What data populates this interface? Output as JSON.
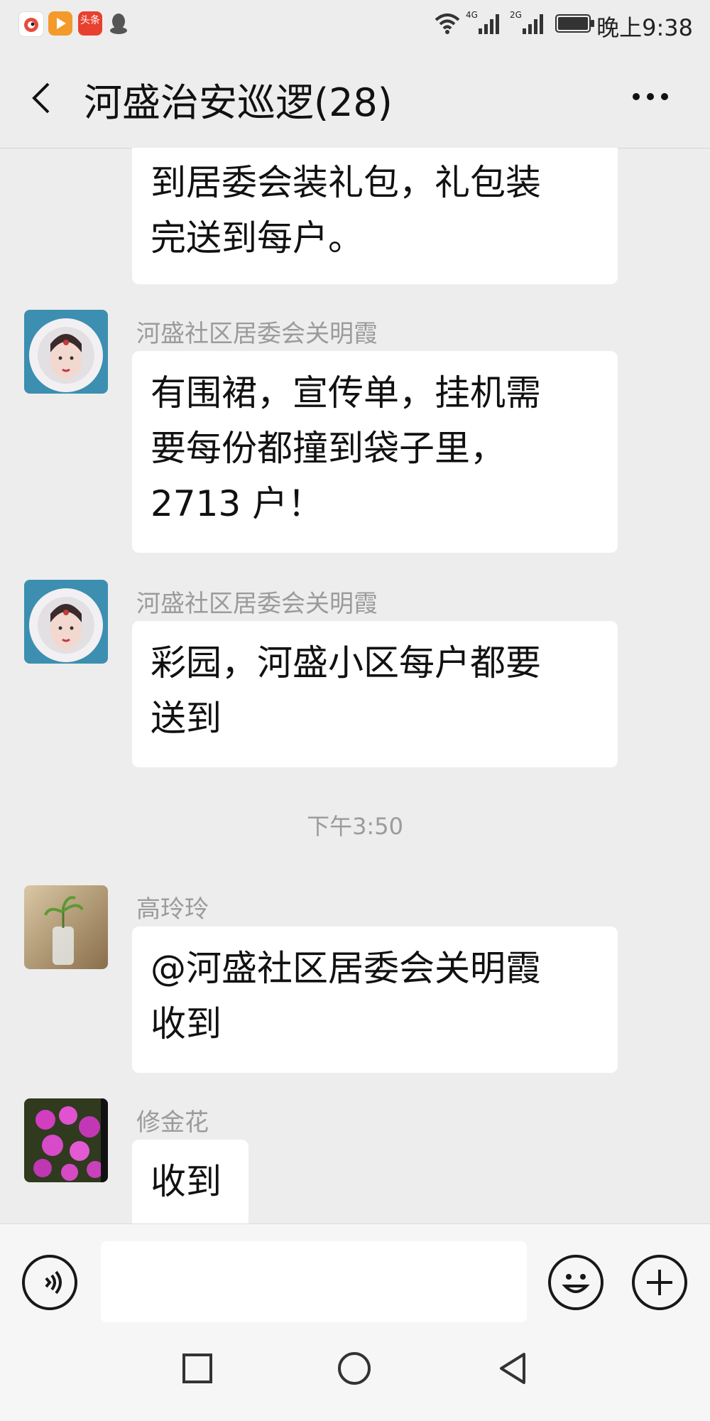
{
  "status_bar": {
    "time": "晚上9:38",
    "network_1": "4G",
    "network_2": "2G",
    "app_icon_2_text": "头条"
  },
  "header": {
    "title": "河盛治安巡逻(28)",
    "back_icon": "chevron-left-icon",
    "more_icon": "more-dots-icon"
  },
  "messages": [
    {
      "text_lines": [
        "到居委会装礼包，礼包装",
        "完送到每户。"
      ]
    },
    {
      "sender": "河盛社区居委会关明霞",
      "text_lines": [
        "有围裙，宣传单，挂机需",
        "要每份都撞到袋子里，",
        "2713 户！"
      ]
    },
    {
      "sender": "河盛社区居委会关明霞",
      "text_lines": [
        "彩园，河盛小区每户都要",
        "送到"
      ]
    },
    {
      "sender": "高玲玲",
      "text_lines": [
        "@河盛社区居委会关明霞",
        "收到"
      ]
    },
    {
      "sender": "修金花",
      "text_lines": [
        "收到"
      ]
    }
  ],
  "time_separator": "下午3:50",
  "input_bar": {
    "voice_icon": "voice-icon",
    "emoji_icon": "emoji-icon",
    "plus_icon": "plus-icon",
    "input_value": ""
  },
  "nav_bar": {
    "recents_icon": "square-icon",
    "home_icon": "circle-icon",
    "back_icon": "triangle-back-icon"
  },
  "colors": {
    "background": "#ededed",
    "bubble": "#ffffff",
    "sender_text": "#9b9b9b"
  }
}
